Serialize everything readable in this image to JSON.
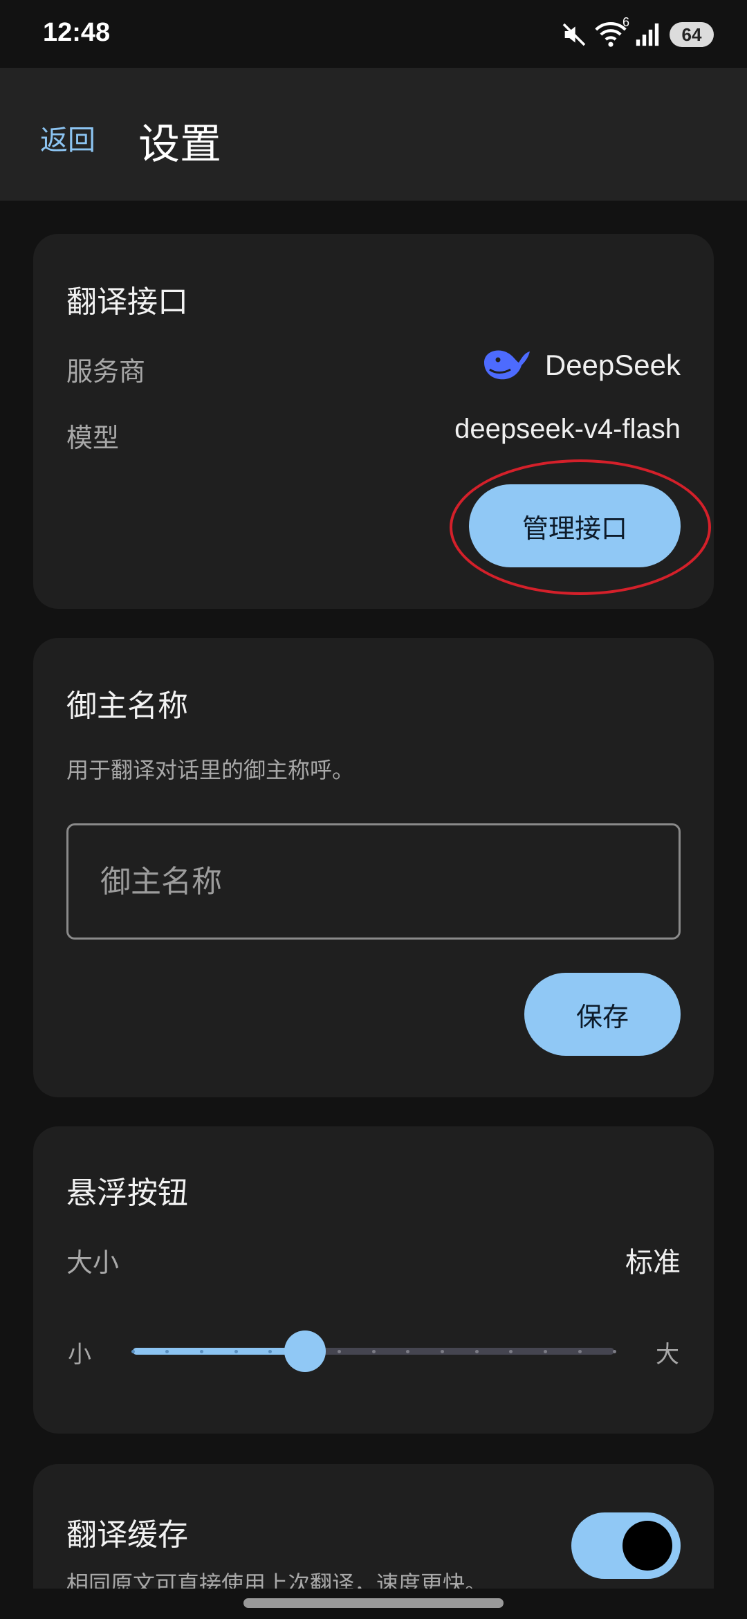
{
  "status_bar": {
    "time": "12:48",
    "battery": "64",
    "wifi_badge": "6",
    "icons": [
      "mute-icon",
      "wifi-icon",
      "signal-icon",
      "battery-icon"
    ]
  },
  "app_bar": {
    "back_label": "返回",
    "title": "设置"
  },
  "translation_api": {
    "title": "翻译接口",
    "provider_label": "服务商",
    "provider_value": "DeepSeek",
    "provider_icon": "deepseek-whale-icon",
    "model_label": "模型",
    "model_value": "deepseek-v4-flash",
    "manage_button": "管理接口"
  },
  "lord_name": {
    "title": "御主名称",
    "description": "用于翻译对话里的御主称呼。",
    "input_value": "",
    "input_placeholder": "御主名称",
    "save_button": "保存"
  },
  "floating_button": {
    "title": "悬浮按钮",
    "size_label": "大小",
    "size_value": "标准",
    "slider_min_label": "小",
    "slider_max_label": "大",
    "slider_steps": 15,
    "slider_value_index": 5
  },
  "translation_cache": {
    "title": "翻译缓存",
    "description": "相同原文可直接使用上次翻译，速度更快。",
    "enabled": true
  },
  "colors": {
    "accent": "#90c8f5",
    "link": "#8cc4f2",
    "highlight_annotation": "#d4202a",
    "card_background": "#1f1f1f",
    "app_bar_background": "#232323",
    "brand_deepseek": "#4d6bfe"
  }
}
